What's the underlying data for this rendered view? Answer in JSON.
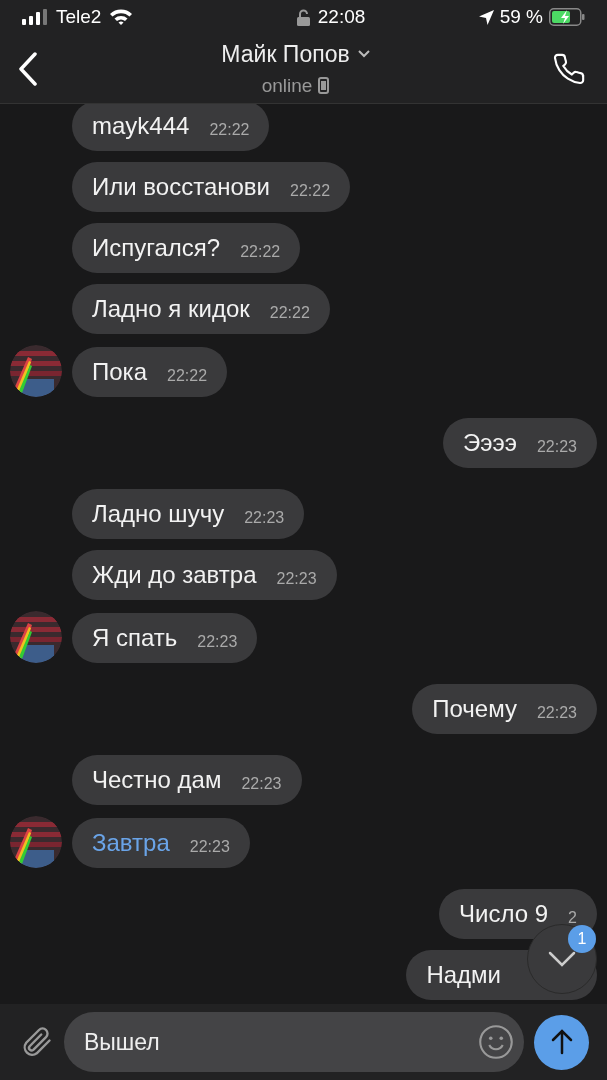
{
  "status_bar": {
    "carrier": "Tele2",
    "time": "22:08",
    "battery": "59 %"
  },
  "header": {
    "title": "Майк Попов",
    "subtitle": "online"
  },
  "messages": [
    {
      "kind": "in",
      "text": "mayk444",
      "time": "22:22",
      "avatar": false,
      "link": false
    },
    {
      "kind": "in",
      "text": "Или восстанови",
      "time": "22:22",
      "avatar": false,
      "link": false
    },
    {
      "kind": "in",
      "text": "Испугался?",
      "time": "22:22",
      "avatar": false,
      "link": false
    },
    {
      "kind": "in",
      "text": "Ладно я кидок",
      "time": "22:22",
      "avatar": false,
      "link": false
    },
    {
      "kind": "in",
      "text": "Пока",
      "time": "22:22",
      "avatar": true,
      "link": false
    },
    {
      "kind": "out",
      "text": "Ээээ",
      "time": "22:23",
      "link": false
    },
    {
      "kind": "in",
      "text": "Ладно шучу",
      "time": "22:23",
      "avatar": false,
      "link": false
    },
    {
      "kind": "in",
      "text": "Жди до завтра",
      "time": "22:23",
      "avatar": false,
      "link": false
    },
    {
      "kind": "in",
      "text": "Я спать",
      "time": "22:23",
      "avatar": true,
      "link": false
    },
    {
      "kind": "out",
      "text": "Почему",
      "time": "22:23",
      "link": false
    },
    {
      "kind": "in",
      "text": "Честно дам",
      "time": "22:23",
      "avatar": false,
      "link": false
    },
    {
      "kind": "in",
      "text": "Завтра",
      "time": "22:23",
      "avatar": true,
      "link": true
    },
    {
      "kind": "out",
      "text": "Число 9",
      "time": "2",
      "link": false
    },
    {
      "kind": "out",
      "text": "Надми",
      "link": false
    }
  ],
  "scroll_button": {
    "badge": "1"
  },
  "composer": {
    "value": "Вышел"
  }
}
